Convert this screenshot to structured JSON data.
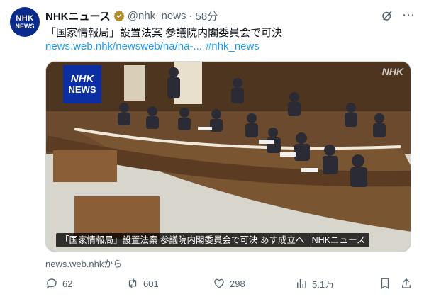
{
  "post": {
    "avatar_line1": "NHK",
    "avatar_line2": "NEWS",
    "author_name": "NHKニュース",
    "handle": "@nhk_news",
    "separator": "·",
    "time": "58分",
    "text": "「国家情報局」設置法案 参議院内閣委員会で可決",
    "link": "news.web.nhk/newsweb/na/na-...",
    "hashtag": "#nhk_news",
    "media": {
      "logo_line1": "NHK",
      "logo_line2": "NEWS",
      "watermark": "NHK",
      "caption": "「国家情報局」設置法案 参議院内閣委員会で可決 あす成立へ | NHKニュース"
    },
    "source": "news.web.nhkから",
    "actions": {
      "replies": "62",
      "reposts": "601",
      "likes": "298",
      "views": "5.1万"
    },
    "colors": {
      "link": "#1d9bf0",
      "muted": "#536471",
      "brand": "#0a2a8c"
    }
  }
}
